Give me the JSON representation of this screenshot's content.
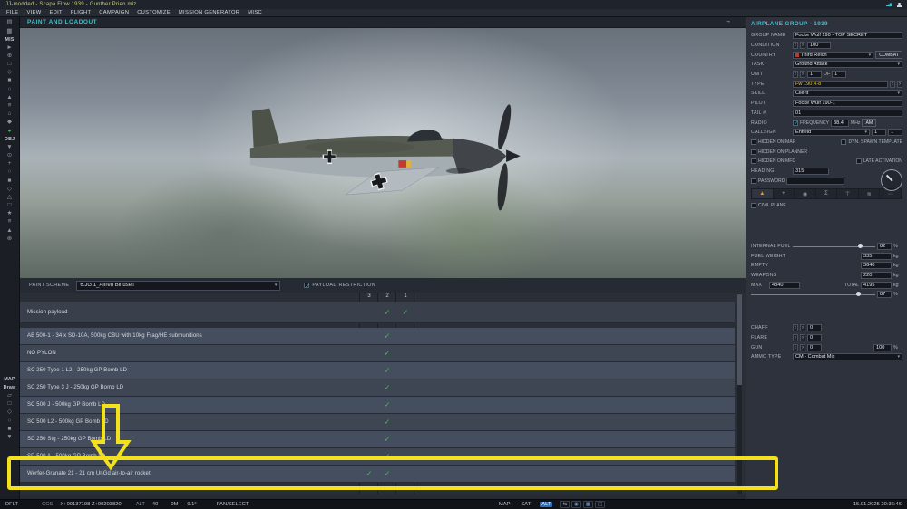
{
  "colors": {
    "accent_teal": "#3fc0cc",
    "check_green": "#42c24e",
    "annotation": "#f2e11c",
    "type_yellow": "#e0c23e",
    "country_red": "#c0392b"
  },
  "glyphs": {
    "check": "✓",
    "caret": "▾",
    "left": "‹",
    "right": "›",
    "collapse": "→",
    "signal_bars": "▂▄▆"
  },
  "title_bar": {
    "title": "JJ-modded - Scapa Flow 1939 - Gunther Prien.miz"
  },
  "menu": [
    "FILE",
    "VIEW",
    "EDIT",
    "FLIGHT",
    "CAMPAIGN",
    "CUSTOMIZE",
    "MISSION GENERATOR",
    "MISC"
  ],
  "left_toolbar": {
    "items": [
      {
        "icon": "▤"
      },
      {
        "icon": "▦"
      },
      {
        "label": "MIS"
      },
      {
        "icon": "►"
      },
      {
        "icon": "⊕"
      },
      {
        "icon": "□"
      },
      {
        "icon": "◇"
      },
      {
        "icon": "■"
      },
      {
        "icon": "○"
      },
      {
        "icon": "▲"
      },
      {
        "icon": "≡"
      },
      {
        "icon": "⌂"
      },
      {
        "icon": "◆"
      },
      {
        "icon": "●",
        "color": "#3ec43e"
      },
      {
        "label": "OBJ"
      },
      {
        "icon": "▼"
      },
      {
        "icon": "⊙"
      },
      {
        "icon": "+"
      },
      {
        "icon": "○"
      },
      {
        "icon": "■"
      },
      {
        "icon": "◇"
      },
      {
        "icon": "△"
      },
      {
        "icon": "□"
      },
      {
        "icon": "★"
      },
      {
        "icon": "≡"
      },
      {
        "icon": "▲"
      },
      {
        "icon": "⊗"
      },
      {
        "gap": 146
      },
      {
        "label": "MAP"
      },
      {
        "label": "Draw"
      },
      {
        "icon": "▱"
      },
      {
        "icon": "□"
      },
      {
        "icon": "◇"
      },
      {
        "icon": "○"
      },
      {
        "icon": "■"
      },
      {
        "icon": "▼"
      }
    ]
  },
  "main": {
    "header": "PAINT AND LOADOUT",
    "paint": {
      "label": "PAINT SCHEME",
      "value": "6.JG 1_Alfred Bindseil",
      "restriction_label": "PAYLOAD RESTRICTION"
    },
    "table": {
      "columns": [
        "3",
        "2",
        "1"
      ],
      "rows": [
        {
          "label": "Mission payload",
          "checks": [
            false,
            true,
            true
          ],
          "kind": "header"
        },
        {
          "label": "AB 500-1 - 34 x SD-10A, 500kg CBU with 10kg Frag/HE submunitions",
          "checks": [
            false,
            true,
            false
          ]
        },
        {
          "label": "NO PYLON",
          "checks": [
            false,
            true,
            false
          ]
        },
        {
          "label": "SC 250 Type 1 L2 - 250kg GP Bomb LD",
          "checks": [
            false,
            true,
            false
          ]
        },
        {
          "label": "SC 250 Type 3 J - 250kg GP Bomb LD",
          "checks": [
            false,
            true,
            false
          ]
        },
        {
          "label": "SC 500 J - 500kg GP Bomb LD",
          "checks": [
            false,
            true,
            false
          ]
        },
        {
          "label": "SC 500 L2 - 500kg GP Bomb LD",
          "checks": [
            false,
            true,
            false
          ]
        },
        {
          "label": "SD 250 Stg - 250kg GP Bomb LD",
          "checks": [
            false,
            true,
            false
          ]
        },
        {
          "label": "SD 500 A - 500kg GP Bomb LD",
          "checks": [
            false,
            true,
            false
          ]
        },
        {
          "label": "Werfer-Granate 21 - 21 cm UnGd air-to-air rocket",
          "checks": [
            true,
            true,
            false
          ]
        }
      ]
    }
  },
  "right_panel": {
    "header": "AIRPLANE GROUP - 1939",
    "group_name": {
      "label": "GROUP NAME",
      "value": "Focke Wulf 190 - TOP SECRET"
    },
    "condition": {
      "label": "CONDITION",
      "value": "100"
    },
    "country": {
      "label": "COUNTRY",
      "value": "Third Reich",
      "combat_label": "COMBAT"
    },
    "task": {
      "label": "TASK",
      "value": "Ground Attack"
    },
    "unit_row": {
      "label": "UNIT",
      "value": "1",
      "of_label": "OF",
      "count": "1"
    },
    "type": {
      "label": "TYPE",
      "value": "Fw 190 A-8"
    },
    "skill": {
      "label": "SKILL",
      "value": "Client"
    },
    "pilot": {
      "label": "PILOT",
      "value": "Focke Wulf 190-1"
    },
    "tail": {
      "label": "TAIL #",
      "value": "01"
    },
    "radio": {
      "label": "RADIO",
      "frequency_label": "FREQUENCY",
      "frequency": "38.4",
      "unit": "MHz",
      "band": "AM"
    },
    "callsign": {
      "label": "CALLSIGN",
      "value": "Enfield",
      "num1": "1",
      "num2": "1"
    },
    "hidden_on_map": "HIDDEN ON MAP",
    "dyn_spawn": "DYN. SPAWN TEMPLATE",
    "hidden_on_planner": "HIDDEN ON PLANNER",
    "hidden_on_mfd": "HIDDEN ON MFD",
    "late_activation": "LATE ACTIVATION",
    "heading": {
      "label": "HEADING",
      "value": "315"
    },
    "password_label": "PASSWORD",
    "civil_plane": "CIVIL PLANE",
    "tabs": [
      "▲",
      "+",
      "◉",
      "Σ",
      "⊤",
      "≋",
      "⋯"
    ],
    "fuel": {
      "internal_label": "INTERNAL FUEL",
      "internal_value": "82",
      "internal_unit": "%",
      "internal_pct": 82,
      "fuel_weight_label": "FUEL WEIGHT",
      "fuel_weight": "335",
      "kg": "kg",
      "empty_label": "EMPTY",
      "empty": "3640",
      "weapons_label": "WEAPONS",
      "weapons": "220",
      "max_label": "MAX",
      "max": "4840",
      "total_label": "TOTAL",
      "total": "4195",
      "load_value": "87",
      "load_unit": "%",
      "load_pct": 87
    },
    "chaff": {
      "label": "CHAFF",
      "value": "0"
    },
    "flare": {
      "label": "FLARE",
      "value": "0"
    },
    "gun": {
      "label": "GUN",
      "value": "0",
      "percent": "100",
      "unit": "%"
    },
    "ammo_type": {
      "label": "AMMO TYPE",
      "value": "CM - Combat Mix"
    }
  },
  "checkboxes": {
    "payload_restriction": true,
    "radio": true,
    "hidden_on_map": false,
    "dyn_spawn": false,
    "hidden_on_planner": false,
    "hidden_on_mfd": false,
    "late_activation": false,
    "password": false,
    "civil_plane": false
  },
  "status_bar": {
    "mode": "DFLT",
    "ccs_label": "CCS",
    "coords": "X+00137198 Z+00203820",
    "alt_label": "ALT",
    "alt_value": "40",
    "elev": "0M",
    "angle": "-9.1°",
    "tool": "PAN/SELECT",
    "map_btn": "MAP",
    "sat_btn": "SAT",
    "alt_btn": "ALT",
    "icon_buttons": [
      "⇆",
      "◉",
      "▦",
      "◫"
    ],
    "datetime": "15.01.2025 20:36:46"
  }
}
